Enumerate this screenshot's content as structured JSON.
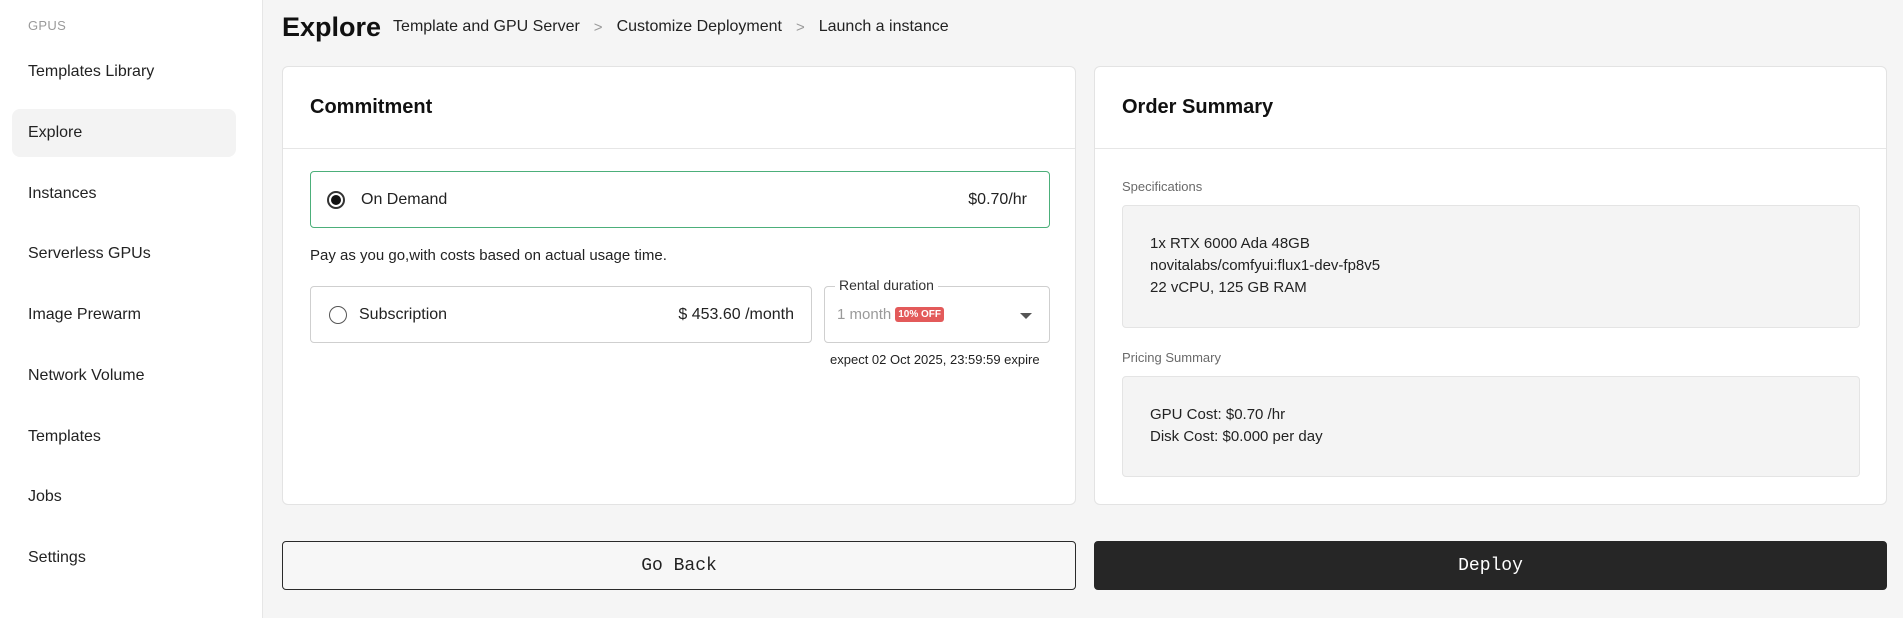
{
  "sidebar": {
    "section": "GPUS",
    "items": [
      {
        "label": "Templates Library"
      },
      {
        "label": "Explore"
      },
      {
        "label": "Instances"
      },
      {
        "label": "Serverless GPUs"
      },
      {
        "label": "Image Prewarm"
      },
      {
        "label": "Network Volume"
      },
      {
        "label": "Templates"
      },
      {
        "label": "Jobs"
      },
      {
        "label": "Settings"
      }
    ],
    "active": "Explore"
  },
  "header": {
    "title": "Explore",
    "breadcrumbs": [
      "Template and GPU Server",
      "Customize Deployment",
      "Launch a instance"
    ],
    "separator": ">"
  },
  "commitment": {
    "title": "Commitment",
    "on_demand": {
      "label": "On Demand",
      "price": "$0.70/hr",
      "selected": true
    },
    "description": "Pay as you go,with costs based on actual usage time.",
    "subscription": {
      "label": "Subscription",
      "price": "$ 453.60 /month",
      "selected": false
    },
    "rental": {
      "legend": "Rental duration",
      "value": "1 month",
      "badge": "10% OFF"
    },
    "expire_text": "expect  02 Oct 2025, 23:59:59 expire"
  },
  "summary": {
    "title": "Order Summary",
    "spec_label": "Specifications",
    "specs": [
      "1x RTX 6000 Ada 48GB",
      "novitalabs/comfyui:flux1-dev-fp8v5",
      "22 vCPU, 125 GB RAM"
    ],
    "pricing_label": "Pricing Summary",
    "pricing": [
      "GPU Cost: $0.70 /hr",
      "Disk Cost: $0.000 per day"
    ]
  },
  "actions": {
    "back": "Go Back",
    "deploy": "Deploy"
  },
  "colors": {
    "accent_border": "#4caf7a",
    "badge": "#e35a5a",
    "deploy_bg": "#262626"
  }
}
